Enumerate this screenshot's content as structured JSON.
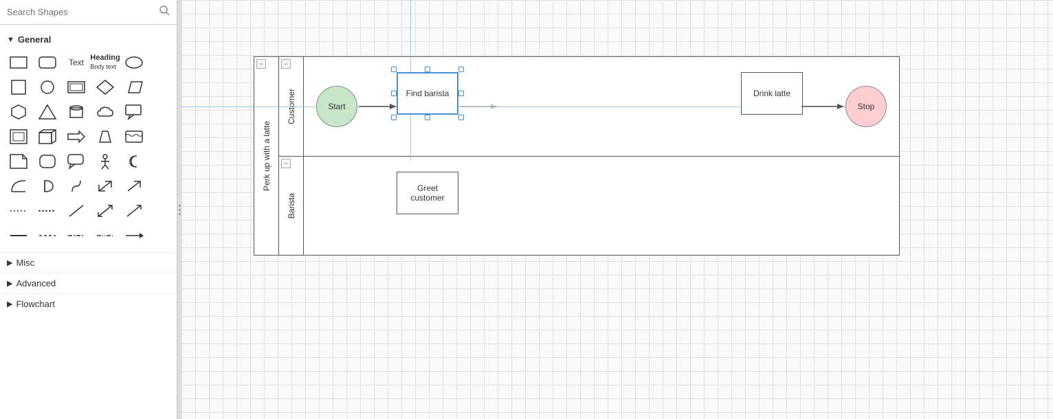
{
  "leftPanel": {
    "search": {
      "placeholder": "Search Shapes",
      "value": ""
    },
    "sections": {
      "general": {
        "label": "General",
        "expanded": true
      },
      "misc": {
        "label": "Misc",
        "expanded": false
      },
      "advanced": {
        "label": "Advanced",
        "expanded": false
      },
      "flowchart": {
        "label": "Flowchart",
        "expanded": false
      }
    }
  },
  "diagram": {
    "outerTitle": "Perk up with a latte",
    "lanes": [
      {
        "id": "customer",
        "label": "Customer",
        "shapes": [
          {
            "id": "start",
            "type": "circle",
            "label": "Start",
            "color": "#c8e6c9"
          },
          {
            "id": "find-barista",
            "type": "rect",
            "label": "Find barista",
            "selected": true
          },
          {
            "id": "drink-latte",
            "type": "rect",
            "label": "Drink latte"
          },
          {
            "id": "stop",
            "type": "circle",
            "label": "Stop",
            "color": "#ffcdd2"
          }
        ]
      },
      {
        "id": "barista",
        "label": "Barista",
        "shapes": [
          {
            "id": "greet-customer",
            "type": "rect",
            "label": "Greet\ncustomer"
          }
        ]
      }
    ],
    "collapseBtn": "−"
  },
  "icons": {
    "search": "🔍",
    "expand": "▶",
    "collapse": "▼",
    "minus": "−"
  }
}
